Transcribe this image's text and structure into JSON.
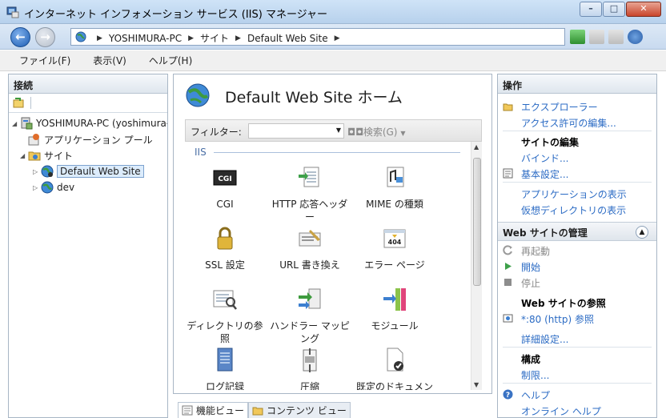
{
  "window": {
    "title": "インターネット インフォメーション サービス (IIS) マネージャー"
  },
  "address": {
    "crumbs": [
      "YOSHIMURA-PC",
      "サイト",
      "Default Web Site"
    ]
  },
  "menu": [
    "ファイル(F)",
    "表示(V)",
    "ヘルプ(H)"
  ],
  "connections": {
    "header": "接続",
    "tree": [
      {
        "label": "YOSHIMURA-PC (yoshimura-PC\\yoshimura)",
        "level": 0,
        "expand": "◢",
        "icon": "server-icon"
      },
      {
        "label": "アプリケーション プール",
        "level": 1,
        "expand": "",
        "icon": "app-pool-icon"
      },
      {
        "label": "サイト",
        "level": 1,
        "expand": "◢",
        "icon": "sites-folder-icon"
      },
      {
        "label": "Default Web Site",
        "level": 2,
        "expand": "▷",
        "icon": "globe-icon",
        "selected": true
      },
      {
        "label": "dev",
        "level": 2,
        "expand": "▷",
        "icon": "globe-icon"
      }
    ]
  },
  "center": {
    "title": "Default Web Site ホーム",
    "filter_label": "フィルター:",
    "filter_value": "",
    "search_label": "検索(G)",
    "group": "IIS",
    "features": [
      {
        "label": "CGI",
        "icon": "cgi-icon"
      },
      {
        "label": "HTTP 応答ヘッダー",
        "icon": "http-headers-icon"
      },
      {
        "label": "MIME の種類",
        "icon": "mime-types-icon"
      },
      {
        "label": "SSL 設定",
        "icon": "lock-icon"
      },
      {
        "label": "URL 書き換え",
        "icon": "url-rewrite-icon"
      },
      {
        "label": "エラー ページ",
        "icon": "error-page-icon"
      },
      {
        "label": "ディレクトリの参照",
        "icon": "directory-browsing-icon"
      },
      {
        "label": "ハンドラー マッピング",
        "icon": "handler-mappings-icon"
      },
      {
        "label": "モジュール",
        "icon": "modules-icon"
      },
      {
        "label": "ログ記録",
        "icon": "logging-icon"
      },
      {
        "label": "圧縮",
        "icon": "compression-icon"
      },
      {
        "label": "既定のドキュメント",
        "icon": "default-document-icon"
      }
    ],
    "tabs": [
      {
        "label": "機能ビュー",
        "active": true
      },
      {
        "label": "コンテンツ ビュー",
        "active": false
      }
    ]
  },
  "actions": {
    "header": "操作",
    "items": [
      {
        "label": "エクスプローラー",
        "kind": "link",
        "icon": "explore-icon"
      },
      {
        "label": "アクセス許可の編集...",
        "kind": "link"
      },
      {
        "label": "サイトの編集",
        "kind": "head"
      },
      {
        "label": "バインド...",
        "kind": "link"
      },
      {
        "label": "基本設定...",
        "kind": "link",
        "icon": "basic-settings-icon"
      },
      {
        "label": "アプリケーションの表示",
        "kind": "link"
      },
      {
        "label": "仮想ディレクトリの表示",
        "kind": "link"
      }
    ],
    "manage_header": "Web サイトの管理",
    "manage_items": [
      {
        "label": "再起動",
        "kind": "dis",
        "icon": "restart-icon"
      },
      {
        "label": "開始",
        "kind": "link",
        "icon": "start-icon"
      },
      {
        "label": "停止",
        "kind": "dis",
        "icon": "stop-icon"
      },
      {
        "label": "Web サイトの参照",
        "kind": "head"
      },
      {
        "label": "*:80 (http) 参照",
        "kind": "link",
        "icon": "browse-icon"
      },
      {
        "label": "詳細設定...",
        "kind": "link"
      },
      {
        "label": "構成",
        "kind": "head"
      },
      {
        "label": "制限...",
        "kind": "link"
      },
      {
        "label": "ヘルプ",
        "kind": "link",
        "icon": "help-icon"
      },
      {
        "label": "オンライン ヘルプ",
        "kind": "link"
      }
    ]
  }
}
